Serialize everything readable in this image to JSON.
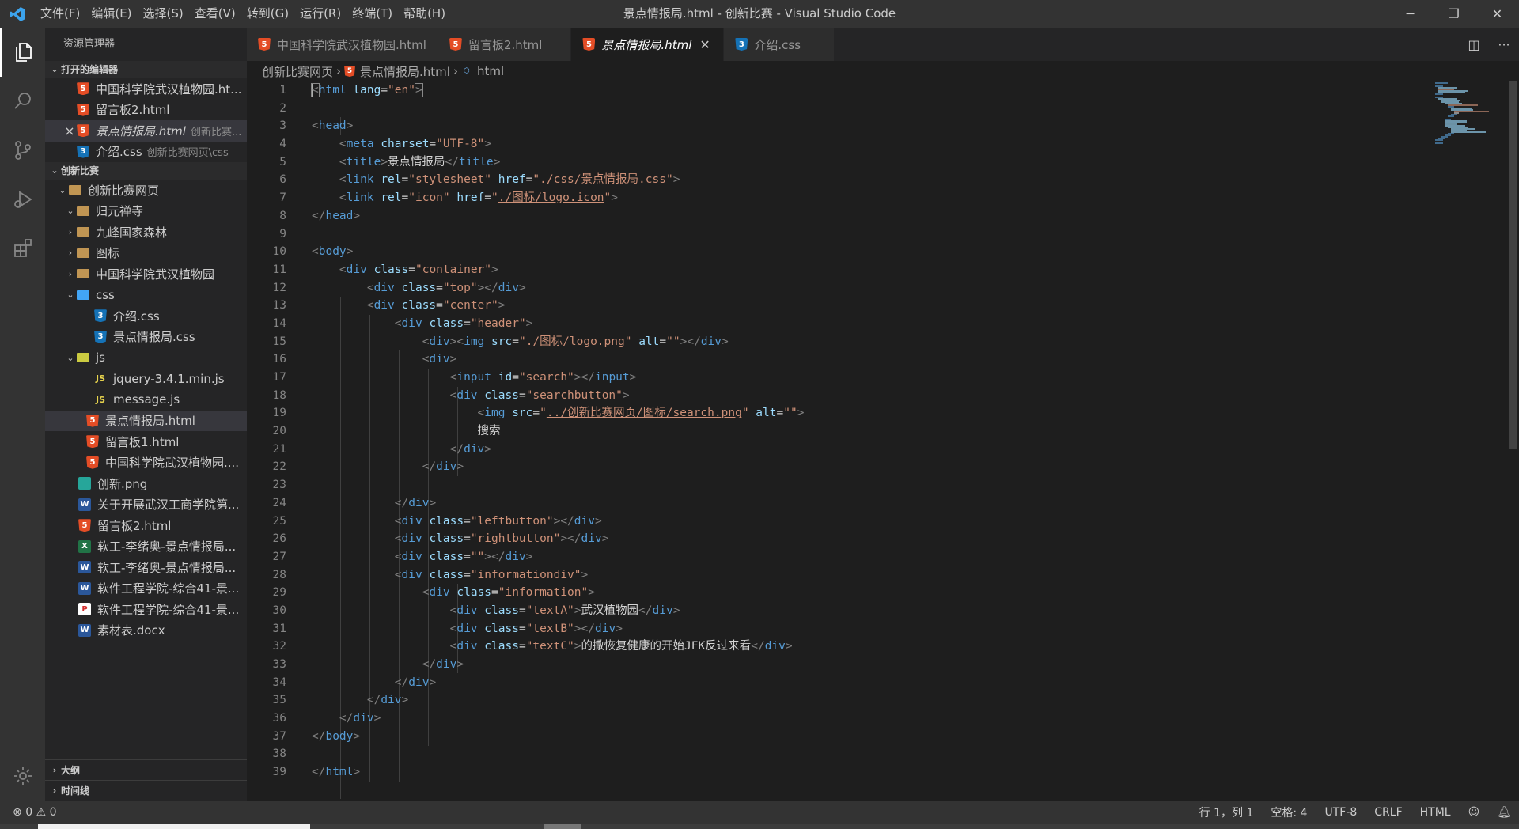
{
  "titlebar": {
    "menu": [
      "文件(F)",
      "编辑(E)",
      "选择(S)",
      "查看(V)",
      "转到(G)",
      "运行(R)",
      "终端(T)",
      "帮助(H)"
    ],
    "window_title": "景点情报局.html - 创新比赛 - Visual Studio Code"
  },
  "sidebar": {
    "title": "资源管理器",
    "open_editors_header": "打开的编辑器",
    "open_editors": [
      {
        "name": "中国科学院武汉植物园.ht...",
        "icon": "html-icon"
      },
      {
        "name": "留言板2.html",
        "icon": "html-icon"
      },
      {
        "name": "景点情报局.html",
        "desc": "创新比赛...",
        "icon": "html-icon"
      },
      {
        "name": "介绍.css",
        "desc": "创新比赛网页\\css",
        "icon": "css-icon"
      }
    ],
    "workspace_header": "创新比赛",
    "tree": {
      "root_folder": "创新比赛网页",
      "f1": "归元禅寺",
      "f2": "九峰国家森林",
      "f3": "图标",
      "f4": "中国科学院武汉植物园",
      "css_folder": "css",
      "css1": "介绍.css",
      "css2": "景点情报局.css",
      "js_folder": "js",
      "js1": "jquery-3.4.1.min.js",
      "js2": "message.js",
      "h1": "景点情报局.html",
      "h2": "留言板1.html",
      "h3": "中国科学院武汉植物园....",
      "r1": "创新.png",
      "r2": "关于开展武汉工商学院第...",
      "r3": "留言板2.html",
      "r4": "软工-李绪奥-景点情报局...",
      "r5": "软工-李绪奥-景点情报局...",
      "r6": "软件工程学院-综合41-景...",
      "r7": "软件工程学院-综合41-景...",
      "r8": "素材表.docx"
    },
    "outline": "大纲",
    "timeline": "时间线"
  },
  "tabs": [
    {
      "label": "中国科学院武汉植物园.html"
    },
    {
      "label": "留言板2.html"
    },
    {
      "label": "景点情报局.html"
    },
    {
      "label": "介绍.css"
    }
  ],
  "breadcrumb": {
    "folder": "创新比赛网页",
    "file": "景点情报局.html",
    "symbol": "html"
  },
  "line_numbers": [
    "1",
    "2",
    "3",
    "4",
    "5",
    "6",
    "7",
    "8",
    "9",
    "10",
    "11",
    "12",
    "13",
    "14",
    "15",
    "16",
    "17",
    "18",
    "19",
    "20",
    "21",
    "22",
    "23",
    "24",
    "25",
    "26",
    "27",
    "28",
    "29",
    "30",
    "31",
    "32",
    "33",
    "34",
    "35",
    "36",
    "37",
    "38",
    "39"
  ],
  "code": {
    "l1_attr": "\"en\"",
    "l4_val": "\"UTF-8\"",
    "l5_text": "景点情报局",
    "l6_link": "./css/景点情报局.css",
    "l7_link": "./图标/logo.icon",
    "l11_val": "\"container\"",
    "l12_val": "\"top\"",
    "l13_val": "\"center\"",
    "l14_val": "\"header\"",
    "l15_link": "./图标/logo.png",
    "l17_val": "\"search\"",
    "l18_val": "\"searchbutton\"",
    "l19_link": "../创新比赛网页/图标/search.png",
    "l20_text": "搜索",
    "l25_val": "\"leftbutton\"",
    "l26_val": "\"rightbutton\"",
    "l27_val": "\"\"",
    "l28_val": "\"informationdiv\"",
    "l29_val": "\"information\"",
    "l30_val": "\"textA\"",
    "l30_text": "武汉植物园",
    "l31_val": "\"textB\"",
    "l32_val": "\"textC\"",
    "l32_text": "的撒恢复健康的开始JFK反过来看"
  },
  "statusbar": {
    "errors": "0",
    "warnings": "0",
    "position": "行 1，列 1",
    "spaces": "空格: 4",
    "encoding": "UTF-8",
    "eol": "CRLF",
    "language": "HTML"
  }
}
